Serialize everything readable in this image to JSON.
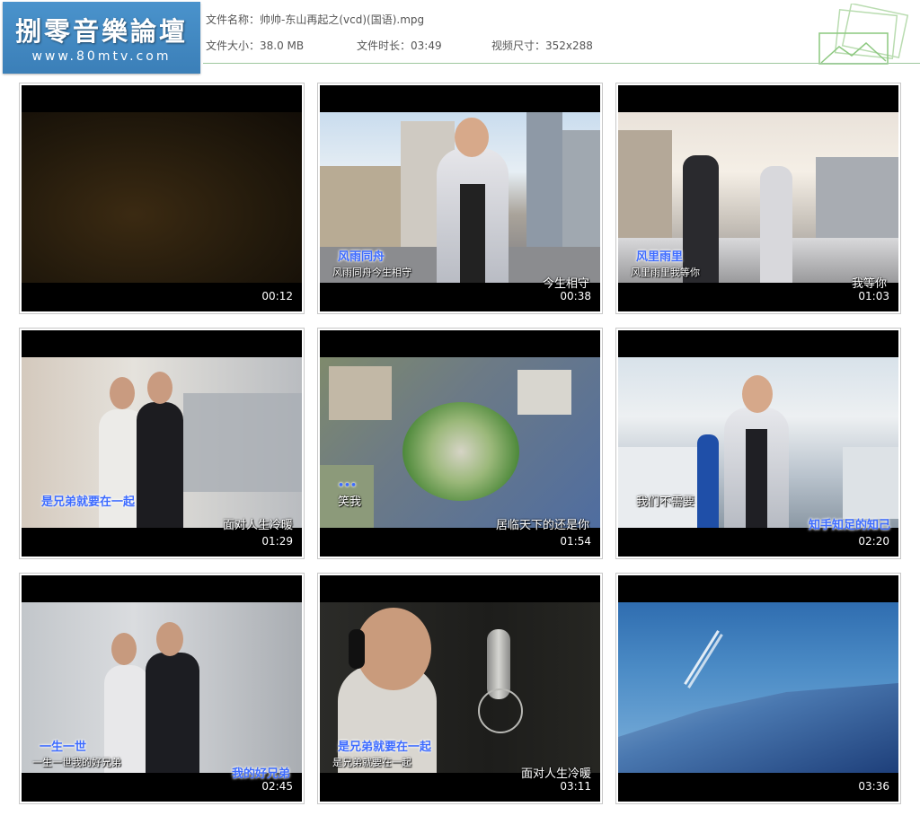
{
  "header": {
    "logo_title": "捌零音樂論壇",
    "logo_url": "www.80mtv.com",
    "file_name_label": "文件名称：",
    "file_name": "帅帅-东山再起之(vcd)(国语).mpg",
    "file_size_label": "文件大小：",
    "file_size": "38.0 MB",
    "duration_label": "文件时长：",
    "duration": "03:49",
    "dimensions_label": "视频尺寸：",
    "dimensions": "352x288"
  },
  "thumbnails": [
    {
      "time": "00:12",
      "subs": []
    },
    {
      "time": "00:38",
      "subs": [
        "风雨同舟",
        "风雨同舟今生相守",
        "今生相守"
      ]
    },
    {
      "time": "01:03",
      "subs": [
        "风里雨里",
        "风里雨里我等你",
        "我等你"
      ]
    },
    {
      "time": "01:29",
      "subs": [
        "是兄弟就要在一起",
        "面对人生冷暖"
      ]
    },
    {
      "time": "01:54",
      "subs": [
        "••• ",
        "笑我",
        "居临天下的还是你"
      ]
    },
    {
      "time": "02:20",
      "subs": [
        "我们不需要",
        "知手知足的知己"
      ]
    },
    {
      "time": "02:45",
      "subs": [
        "一生一世",
        "一生一世我的好兄弟",
        "我的好兄弟"
      ]
    },
    {
      "time": "03:11",
      "subs": [
        "是兄弟就要在一起",
        "是兄弟就要在一起",
        "面对人生冷暖"
      ]
    },
    {
      "time": "03:36",
      "subs": []
    }
  ],
  "colors": {
    "logo_bg": "#4a93cc",
    "rule": "#9ec79e",
    "highlight_sub": "#3d6bff"
  }
}
